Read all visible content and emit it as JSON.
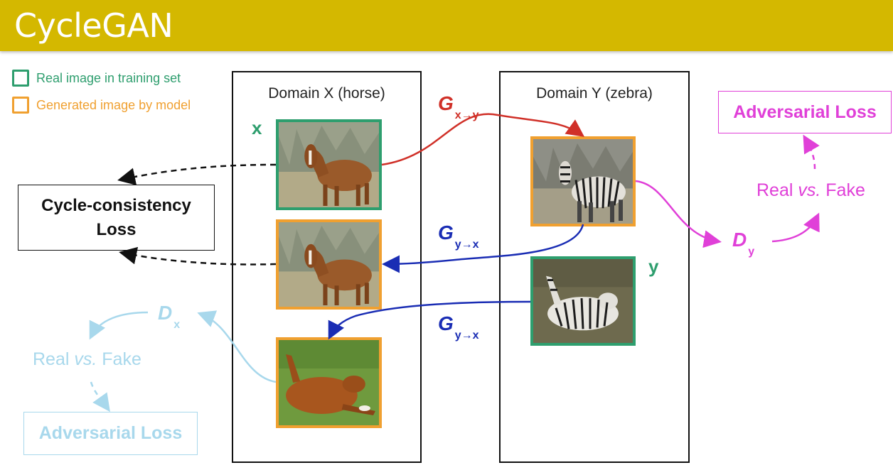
{
  "header": {
    "title": "CycleGAN",
    "bg_color": "#d4b800"
  },
  "legend": {
    "real": {
      "label": "Real image in training set",
      "color": "#2e9e6e"
    },
    "generated": {
      "label": "Generated image by model",
      "color": "#f0a030"
    }
  },
  "domains": {
    "x": {
      "title": "Domain X (horse)",
      "var_label": "x"
    },
    "y": {
      "title": "Domain Y (zebra)",
      "var_label": "y"
    }
  },
  "generators": {
    "g_xy": {
      "symbol": "G",
      "subscript": "x→y",
      "color": "#d03028"
    },
    "g_yx_top": {
      "symbol": "G",
      "subscript": "y→x",
      "color": "#1a2db4"
    },
    "g_yx_bottom": {
      "symbol": "G",
      "subscript": "y→x",
      "color": "#1a2db4"
    }
  },
  "losses": {
    "cycle": {
      "label": "Cycle-consistency Loss"
    },
    "adversarial_y": {
      "label": "Adversarial Loss",
      "color": "#e040d8"
    },
    "adversarial_x": {
      "label": "Adversarial Loss",
      "color": "#a8d8ec"
    }
  },
  "discriminators": {
    "d_y": {
      "symbol": "D",
      "subscript": "y",
      "color": "#e040d8",
      "rvf_pre": "Real ",
      "rvf_vs": "vs.",
      "rvf_post": " Fake"
    },
    "d_x": {
      "symbol": "D",
      "subscript": "x",
      "color": "#a8d8ec",
      "rvf_pre": "Real ",
      "rvf_vs": "vs.",
      "rvf_post": " Fake"
    }
  }
}
